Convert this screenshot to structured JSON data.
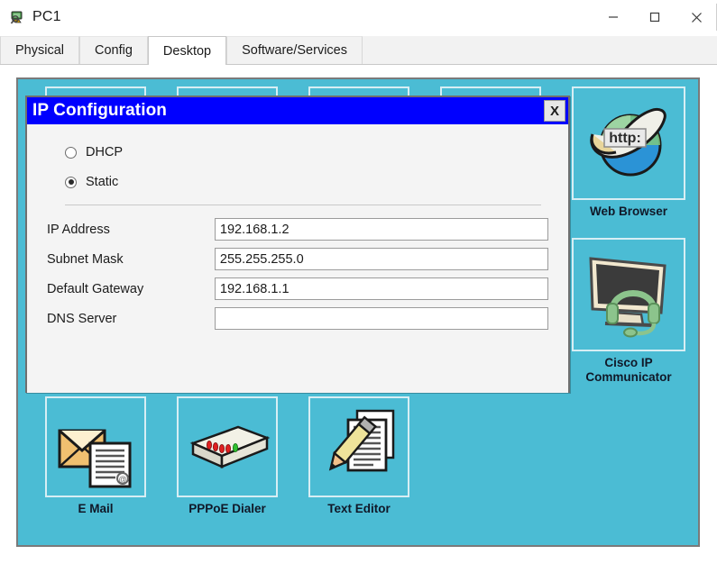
{
  "window": {
    "title": "PC1",
    "icon": "pc-device-icon",
    "controls": {
      "minimize": "–",
      "maximize": "□",
      "close": "✕"
    }
  },
  "tabs": [
    {
      "label": "Physical",
      "active": false
    },
    {
      "label": "Config",
      "active": false
    },
    {
      "label": "Desktop",
      "active": true
    },
    {
      "label": "Software/Services",
      "active": false
    }
  ],
  "desktop": {
    "background_color": "#4bbcd4",
    "top_row_icons": [
      {
        "label": "",
        "icon": "app-icon-1"
      },
      {
        "label": "",
        "icon": "app-icon-2"
      },
      {
        "label": "",
        "icon": "app-icon-3"
      },
      {
        "label": "",
        "icon": "app-icon-4"
      }
    ],
    "occluded_label": "PPPoE Dialer",
    "bottom_row_icons": [
      {
        "label": "E Mail",
        "icon": "envelope-document-icon"
      },
      {
        "label": "PPPoE Dialer",
        "icon": "modem-icon"
      },
      {
        "label": "Text Editor",
        "icon": "pencil-documents-icon"
      }
    ],
    "right_column_icons": [
      {
        "label": "Web Browser",
        "icon": "web-browser-globe-icon",
        "badge": "http:"
      },
      {
        "label": "Cisco IP\nCommunicator",
        "label_line1": "Cisco IP",
        "label_line2": "Communicator",
        "icon": "monitor-headset-icon"
      }
    ]
  },
  "dialog": {
    "title": "IP Configuration",
    "close_label": "X",
    "titlebar_color": "#0000ff",
    "mode_options": [
      {
        "label": "DHCP",
        "selected": false
      },
      {
        "label": "Static",
        "selected": true
      }
    ],
    "fields": [
      {
        "label": "IP Address",
        "value": "192.168.1.2",
        "placeholder": ""
      },
      {
        "label": "Subnet Mask",
        "value": "255.255.255.0",
        "placeholder": ""
      },
      {
        "label": "Default Gateway",
        "value": "192.168.1.1",
        "placeholder": ""
      },
      {
        "label": "DNS Server",
        "value": "",
        "placeholder": ""
      }
    ]
  }
}
